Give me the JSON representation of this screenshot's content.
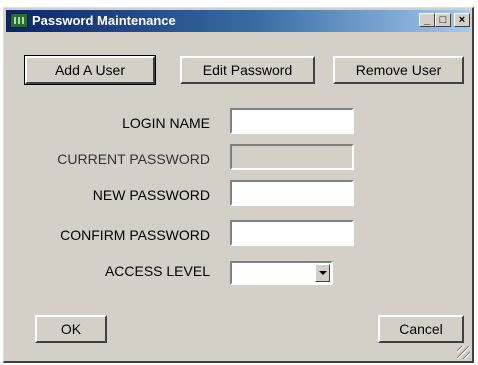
{
  "window": {
    "title": "Password Maintenance",
    "minimize_label": "_",
    "maximize_label": "□",
    "close_label": "×"
  },
  "toolbar": {
    "add_user": "Add A User",
    "edit_password": "Edit Password",
    "remove_user": "Remove User"
  },
  "form": {
    "login_name_label": "LOGIN NAME",
    "login_name_value": "",
    "current_password_label": "CURRENT PASSWORD",
    "current_password_value": "",
    "new_password_label": "NEW PASSWORD",
    "new_password_value": "",
    "confirm_password_label": "CONFIRM PASSWORD",
    "confirm_password_value": "",
    "access_level_label": "ACCESS LEVEL",
    "access_level_value": ""
  },
  "footer": {
    "ok": "OK",
    "cancel": "Cancel"
  }
}
